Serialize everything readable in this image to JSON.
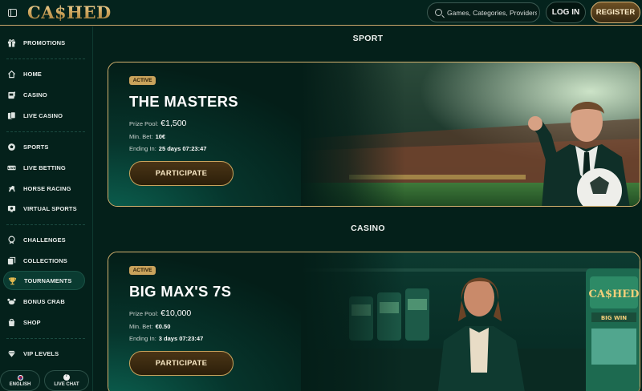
{
  "header": {
    "logo_text": "CA$HED",
    "search_placeholder": "Games, Categories, Providers",
    "login_label": "LOG IN",
    "register_label": "REGISTER"
  },
  "sidebar": {
    "items": [
      {
        "label": "PROMOTIONS",
        "icon": "gift-icon"
      },
      {
        "label": "HOME",
        "icon": "home-icon"
      },
      {
        "label": "CASINO",
        "icon": "slot-machine-icon"
      },
      {
        "label": "LIVE CASINO",
        "icon": "cards-icon"
      },
      {
        "label": "SPORTS",
        "icon": "football-icon"
      },
      {
        "label": "LIVE BETTING",
        "icon": "live-icon"
      },
      {
        "label": "HORSE RACING",
        "icon": "horse-icon"
      },
      {
        "label": "VIRTUAL SPORTS",
        "icon": "monitor-icon"
      },
      {
        "label": "CHALLENGES",
        "icon": "medal-icon"
      },
      {
        "label": "COLLECTIONS",
        "icon": "collection-icon"
      },
      {
        "label": "TOURNAMENTS",
        "icon": "trophy-icon"
      },
      {
        "label": "BONUS CRAB",
        "icon": "crab-icon"
      },
      {
        "label": "SHOP",
        "icon": "shop-icon"
      },
      {
        "label": "VIP LEVELS",
        "icon": "diamond-icon"
      }
    ],
    "active_item": "TOURNAMENTS",
    "language_label": "ENGLISH",
    "live_chat_label": "LIVE CHAT"
  },
  "sections": [
    {
      "title": "SPORT",
      "card": {
        "badge": "ACTIVE",
        "title": "THE MASTERS",
        "prize_label": "Prize Pool:",
        "prize_value": "€1,500",
        "minbet_label": "Min. Bet:",
        "minbet_value": "10€",
        "ending_label": "Ending In:",
        "ending_value": "25 days 07:23:47",
        "button_label": "PARTICIPATE"
      }
    },
    {
      "title": "CASINO",
      "card": {
        "badge": "ACTIVE",
        "title": "BIG MAX'S 7S",
        "prize_label": "Prize Pool:",
        "prize_value": "€10,000",
        "minbet_label": "Min. Bet:",
        "minbet_value": "€0.50",
        "ending_label": "Ending In:",
        "ending_value": "3 days 07:23:47",
        "button_label": "PARTICIPATE"
      }
    }
  ],
  "colors": {
    "accent_gold": "#c9a35c",
    "background": "#04201a",
    "sidebar_active": "#0a3b31"
  }
}
